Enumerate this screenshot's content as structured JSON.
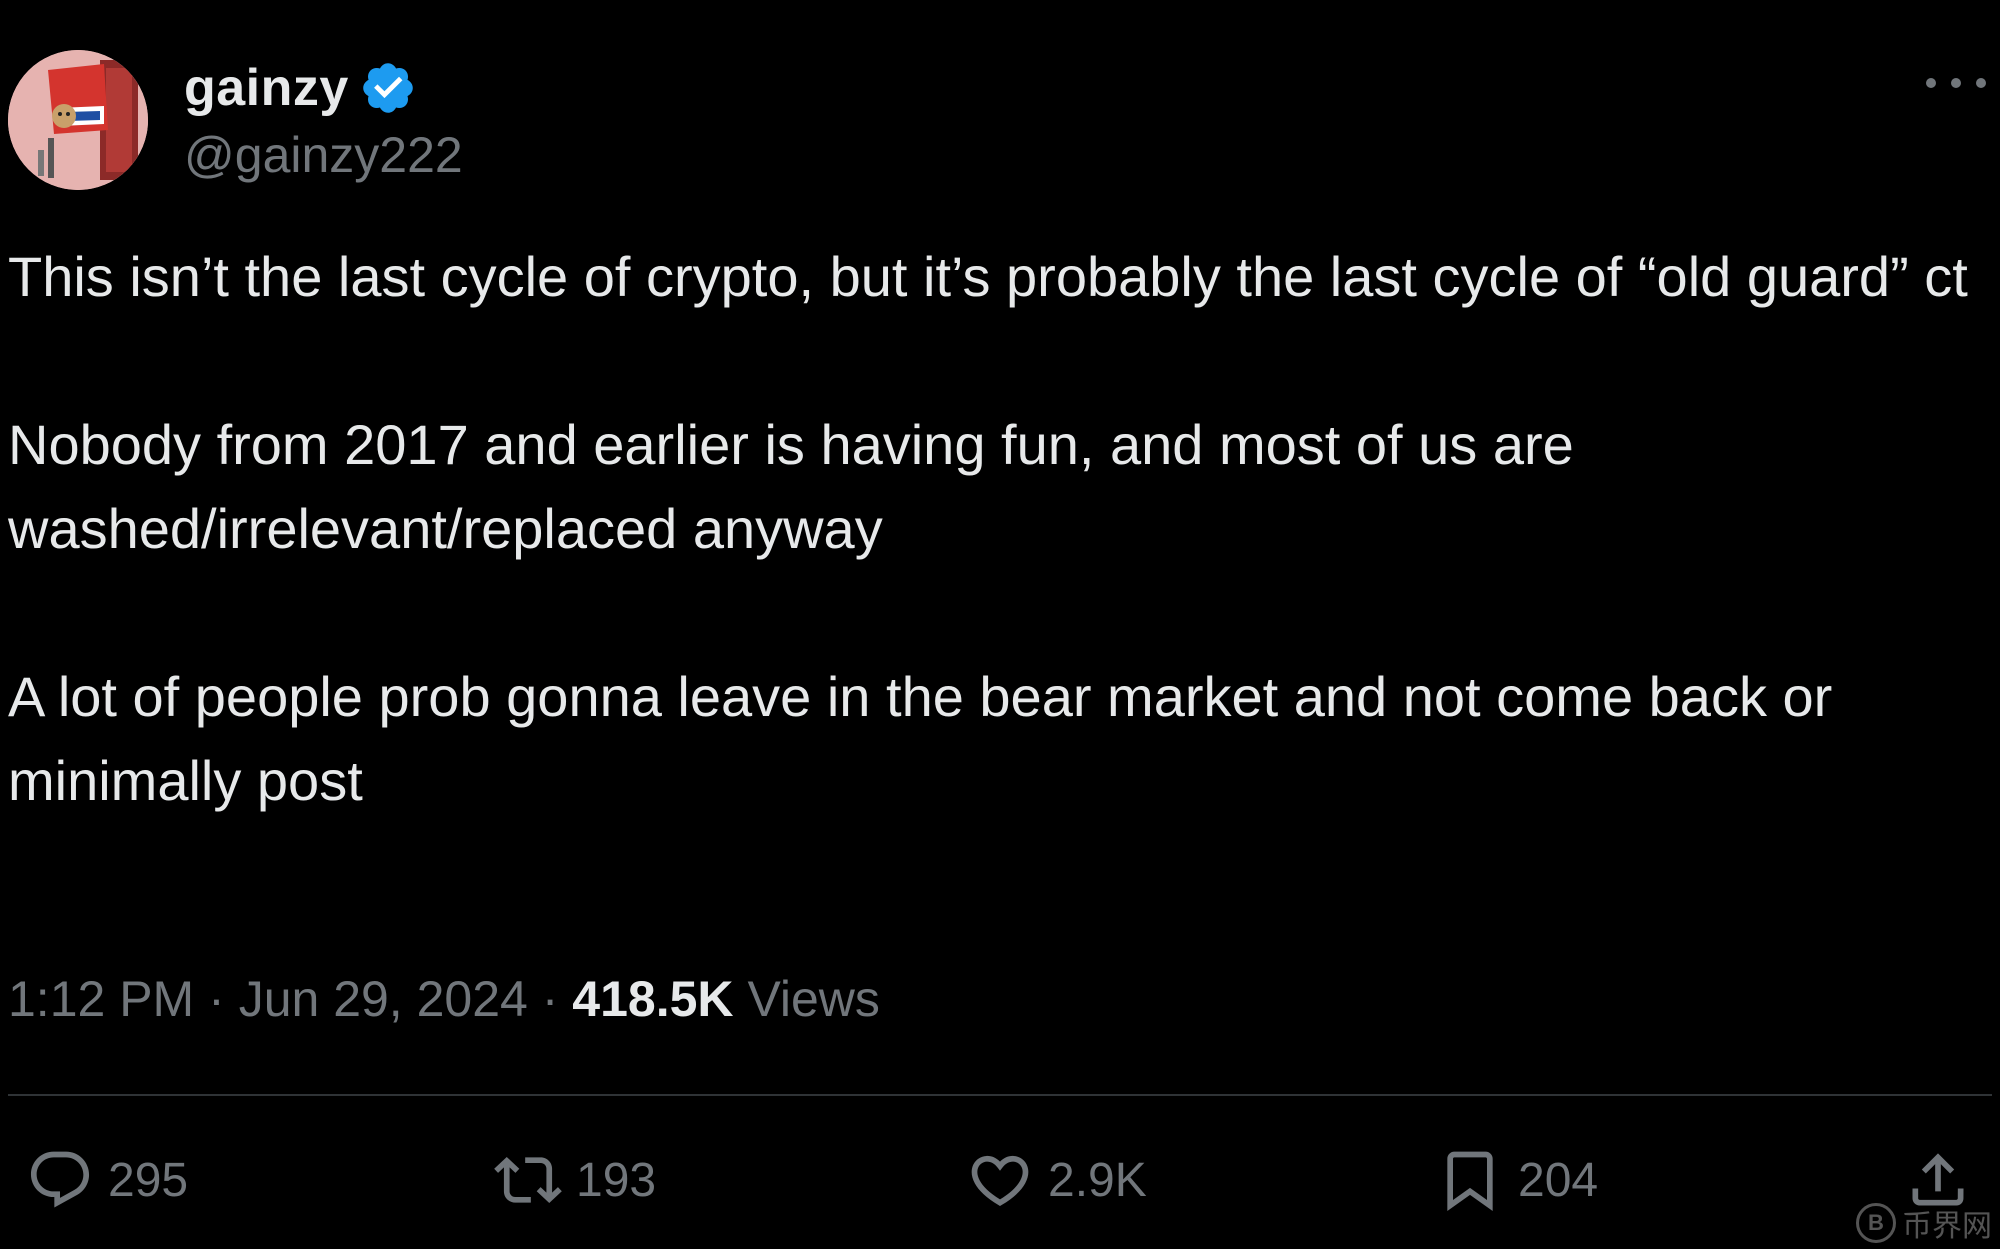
{
  "user": {
    "display_name": "gainzy",
    "handle": "@gainzy222",
    "verified": true
  },
  "tweet": {
    "paragraphs": [
      "This isn’t the last cycle of crypto, but it’s probably the last cycle of “old guard” ct",
      "Nobody from 2017 and earlier is having fun, and most of us are washed/irrelevant/replaced anyway",
      "A lot of people prob gonna leave in the bear market and not come back or minimally post"
    ],
    "time": "1:12 PM",
    "separator": "·",
    "date": "Jun 29, 2024",
    "views_count": "418.5K",
    "views_label": "Views"
  },
  "actions": {
    "replies": "295",
    "reposts": "193",
    "likes": "2.9K",
    "bookmarks": "204"
  },
  "icons": {
    "more": "more-dots-icon",
    "reply": "reply-icon",
    "repost": "repost-icon",
    "like": "heart-icon",
    "bookmark": "bookmark-icon",
    "share": "share-icon",
    "verified": "verified-badge-icon"
  },
  "watermark": {
    "symbol": "B",
    "text": "币界网"
  },
  "colors": {
    "background": "#000000",
    "text": "#e7e9ea",
    "muted": "#71767b",
    "divider": "#2f3336",
    "verified": "#1d9bf0"
  }
}
